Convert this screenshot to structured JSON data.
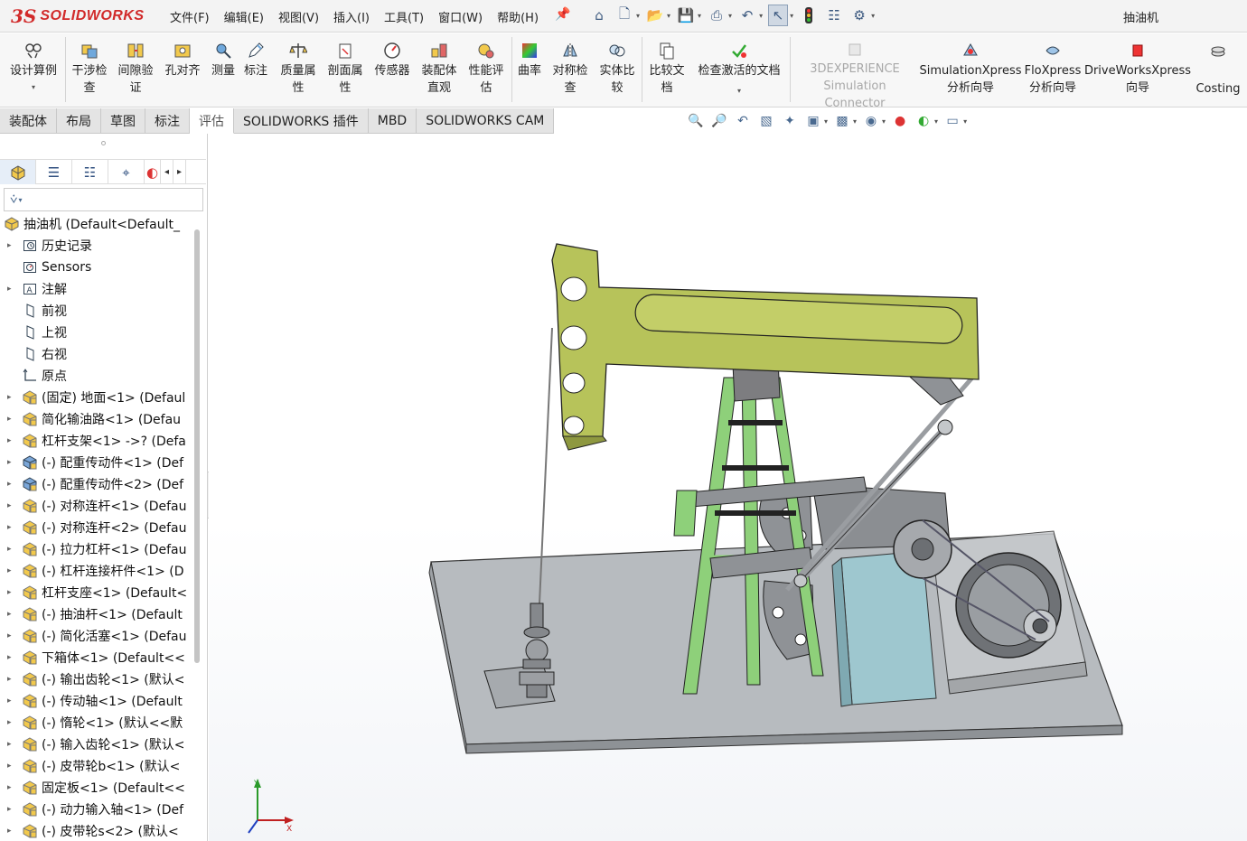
{
  "app": {
    "logo_prefix": "3S",
    "logo_text": "SOLIDWORKS",
    "document_title": "抽油机"
  },
  "menu": [
    "文件(F)",
    "编辑(E)",
    "视图(V)",
    "插入(I)",
    "工具(T)",
    "窗口(W)",
    "帮助(H)"
  ],
  "ribbon": {
    "design_calc": "设计算例",
    "interference": "干涉检\n查",
    "clearance": "间隙验\n证",
    "hole_align": "孔对齐",
    "measure": "测量",
    "markup": "标注",
    "mass_props": "质量属\n性",
    "section_props": "剖面属\n性",
    "sensor": "传感器",
    "assembly_viz": "装配体\n直观",
    "perf_eval": "性能评\n估",
    "curvature": "曲率",
    "symmetry": "对称检\n查",
    "compare_solids": "实体比\n较",
    "compare_docs": "比较文\n档",
    "check_active": "检查激活的文档",
    "experience": "3DEXPERIENCE\nSimulation Connector",
    "simxpress": "SimulationXpress\n分析向导",
    "floxpress": "FloXpress\n分析向导",
    "driveworks": "DriveWorksXpress\n向导",
    "costing": "Costing"
  },
  "tabs": [
    "装配体",
    "布局",
    "草图",
    "标注",
    "评估",
    "SOLIDWORKS 插件",
    "MBD",
    "SOLIDWORKS CAM"
  ],
  "active_tab": "评估",
  "tree": {
    "root": "抽油机 (Default<Default_",
    "items": [
      {
        "label": "历史记录",
        "icon": "history-icon",
        "arrow": true
      },
      {
        "label": "Sensors",
        "icon": "sensors-icon",
        "arrow": false
      },
      {
        "label": "注解",
        "icon": "annotations-icon",
        "arrow": true
      },
      {
        "label": "前视",
        "icon": "plane-icon",
        "arrow": false
      },
      {
        "label": "上视",
        "icon": "plane-icon",
        "arrow": false
      },
      {
        "label": "右视",
        "icon": "plane-icon",
        "arrow": false
      },
      {
        "label": "原点",
        "icon": "origin-icon",
        "arrow": false
      },
      {
        "label": "(固定) 地面<1> (Defaul",
        "icon": "subassembly-icon",
        "arrow": true
      },
      {
        "label": "简化输油路<1> (Defau",
        "icon": "subassembly-icon",
        "arrow": true
      },
      {
        "label": "杠杆支架<1> ->? (Defa",
        "icon": "subassembly-icon",
        "arrow": true
      },
      {
        "label": "(-) 配重传动件<1> (Def",
        "icon": "part-icon",
        "arrow": true
      },
      {
        "label": "(-) 配重传动件<2> (Def",
        "icon": "part-icon",
        "arrow": true
      },
      {
        "label": "(-) 对称连杆<1> (Defau",
        "icon": "subassembly-icon",
        "arrow": true
      },
      {
        "label": "(-) 对称连杆<2> (Defau",
        "icon": "subassembly-icon",
        "arrow": true
      },
      {
        "label": "(-) 拉力杠杆<1> (Defau",
        "icon": "subassembly-icon",
        "arrow": true
      },
      {
        "label": "(-) 杠杆连接杆件<1> (D",
        "icon": "subassembly-icon",
        "arrow": true
      },
      {
        "label": "杠杆支座<1> (Default<",
        "icon": "subassembly-icon",
        "arrow": true
      },
      {
        "label": "(-) 抽油杆<1> (Default",
        "icon": "subassembly-icon",
        "arrow": true
      },
      {
        "label": "(-) 简化活塞<1> (Defau",
        "icon": "subassembly-icon",
        "arrow": true
      },
      {
        "label": "下箱体<1> (Default<<",
        "icon": "subassembly-icon",
        "arrow": true
      },
      {
        "label": "(-) 输出齿轮<1> (默认<",
        "icon": "subassembly-icon",
        "arrow": true
      },
      {
        "label": "(-) 传动轴<1> (Default",
        "icon": "subassembly-icon",
        "arrow": true
      },
      {
        "label": "(-) 惰轮<1> (默认<<默",
        "icon": "subassembly-icon",
        "arrow": true
      },
      {
        "label": "(-) 输入齿轮<1> (默认<",
        "icon": "subassembly-icon",
        "arrow": true
      },
      {
        "label": "(-) 皮带轮b<1> (默认<",
        "icon": "subassembly-icon",
        "arrow": true
      },
      {
        "label": "固定板<1> (Default<<",
        "icon": "subassembly-icon",
        "arrow": true
      },
      {
        "label": "(-) 动力输入轴<1> (Def",
        "icon": "subassembly-icon",
        "arrow": true
      },
      {
        "label": "(-) 皮带轮s<2> (默认<",
        "icon": "subassembly-icon",
        "arrow": true
      }
    ]
  },
  "triad": {
    "x": "X",
    "y": "Y"
  },
  "colors": {
    "beam": "#b7c35a",
    "frame": "#8ed07a",
    "base": "#a9aeb2",
    "pedestal": "#9ec7cf",
    "metal": "#7d7d80",
    "accent": "#d12a2a"
  }
}
